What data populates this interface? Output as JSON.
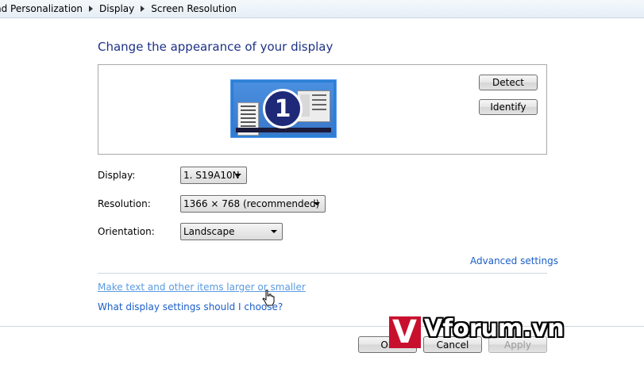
{
  "breadcrumb": {
    "items": [
      "nd Personalization",
      "Display",
      "Screen Resolution"
    ]
  },
  "header": {
    "title": "Change the appearance of your display"
  },
  "preview": {
    "monitor_number": "1",
    "detect_label": "Detect",
    "identify_label": "Identify"
  },
  "settings": {
    "display_label": "Display:",
    "display_value": "1. S19A10N",
    "resolution_label": "Resolution:",
    "resolution_value": "1366 × 768 (recommended)",
    "orientation_label": "Orientation:",
    "orientation_value": "Landscape"
  },
  "links": {
    "advanced_settings": "Advanced settings",
    "text_size": "Make text and other items larger or smaller",
    "help": "What display settings should I choose?"
  },
  "footer": {
    "ok_label": "OK",
    "cancel_label": "Cancel",
    "apply_label": "Apply"
  },
  "watermark": {
    "text": "Vforum.vn",
    "logo_letter": "V"
  },
  "colors": {
    "title": "#1e3287",
    "link": "#1a5ec7",
    "monitor": "#2b7fd6",
    "watermark_red": "#c8102e"
  }
}
